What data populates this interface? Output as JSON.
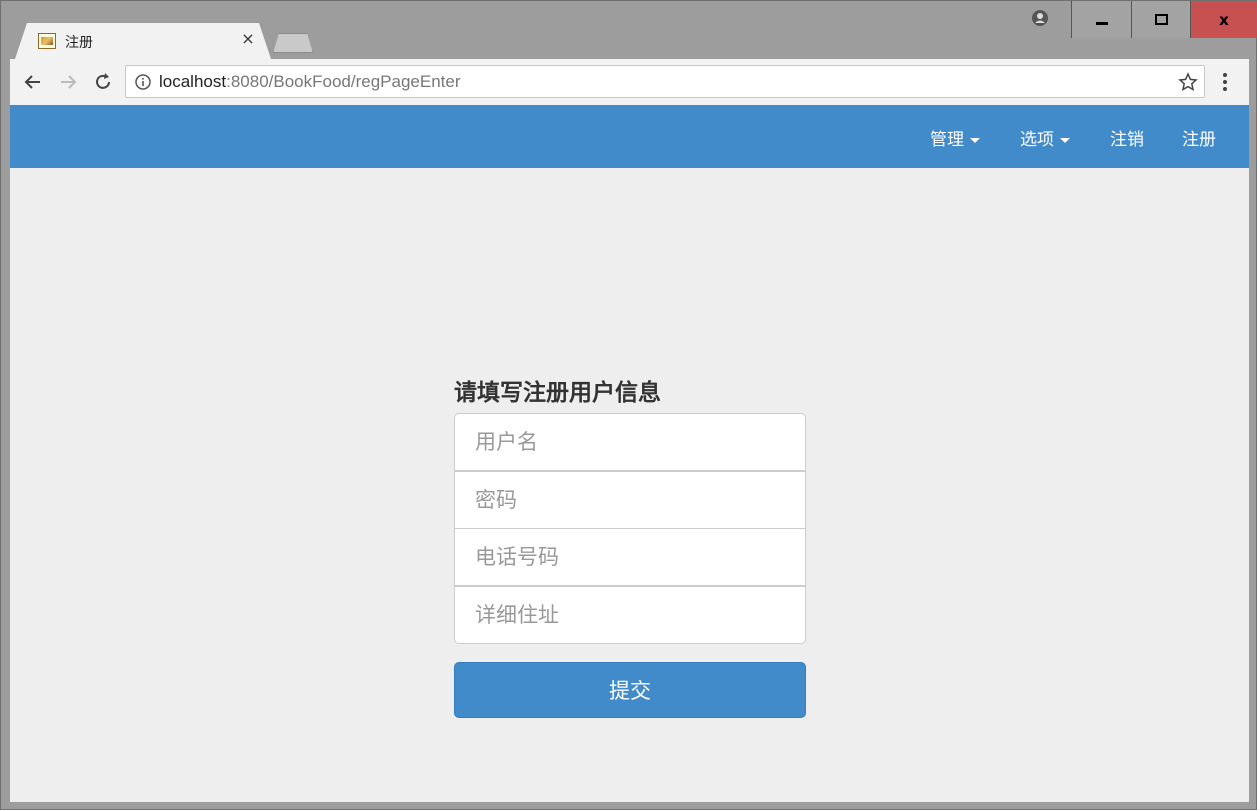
{
  "browser": {
    "tab_title": "注册",
    "tab_close": "×",
    "url_host": "localhost",
    "url_rest": ":8080/BookFood/regPageEnter",
    "window_controls": {
      "close_glyph": "x"
    }
  },
  "navbar": {
    "items": [
      {
        "label": "管理",
        "dropdown": true
      },
      {
        "label": "选项",
        "dropdown": true
      },
      {
        "label": "注销",
        "dropdown": false
      },
      {
        "label": "注册",
        "dropdown": false
      }
    ]
  },
  "form": {
    "heading": "请填写注册用户信息",
    "fields": [
      {
        "placeholder": "用户名",
        "value": ""
      },
      {
        "placeholder": "密码",
        "value": ""
      },
      {
        "placeholder": "电话号码",
        "value": ""
      },
      {
        "placeholder": "详细住址",
        "value": ""
      }
    ],
    "submit_label": "提交"
  },
  "colors": {
    "primary": "#428bca",
    "page_background": "#eeeeee",
    "close_button": "#c75050"
  },
  "icons": [
    "favicon-icon",
    "close-icon",
    "new-tab-icon",
    "profile-icon",
    "minimize-icon",
    "maximize-icon",
    "back-arrow-icon",
    "forward-arrow-icon",
    "reload-icon",
    "info-icon",
    "star-icon",
    "kebab-menu-icon",
    "caret-down-icon"
  ]
}
